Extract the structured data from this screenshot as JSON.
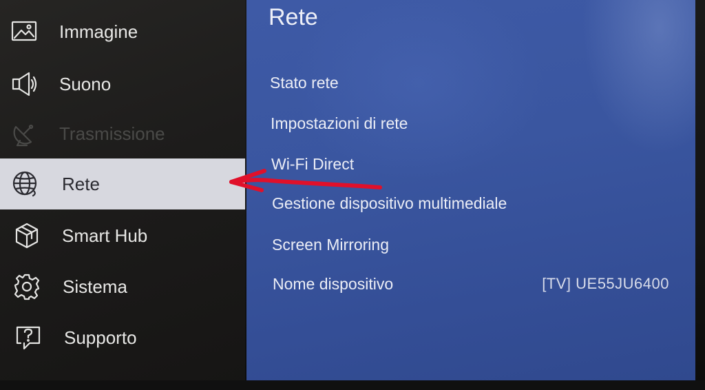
{
  "left_menu": {
    "items": [
      {
        "label": "Immagine",
        "icon": "picture-icon",
        "state": "normal"
      },
      {
        "label": "Suono",
        "icon": "speaker-icon",
        "state": "normal"
      },
      {
        "label": "Trasmissione",
        "icon": "satellite-dish-icon",
        "state": "disabled"
      },
      {
        "label": "Rete",
        "icon": "globe-icon",
        "state": "selected"
      },
      {
        "label": "Smart Hub",
        "icon": "cube-icon",
        "state": "normal"
      },
      {
        "label": "Sistema",
        "icon": "gear-icon",
        "state": "normal"
      },
      {
        "label": "Supporto",
        "icon": "help-icon",
        "state": "normal"
      }
    ]
  },
  "panel": {
    "title": "Rete",
    "items": [
      {
        "label": "Stato rete"
      },
      {
        "label": "Impostazioni di rete"
      },
      {
        "label": "Wi-Fi Direct"
      },
      {
        "label": "Gestione dispositivo multimediale"
      },
      {
        "label": "Screen Mirroring"
      },
      {
        "label": "Nome dispositivo",
        "value": "[TV] UE55JU6400"
      }
    ]
  },
  "colors": {
    "selected_bg": "#d7d8df",
    "panel_blue": "#3a56a0",
    "annotation_red": "#e0102a"
  }
}
